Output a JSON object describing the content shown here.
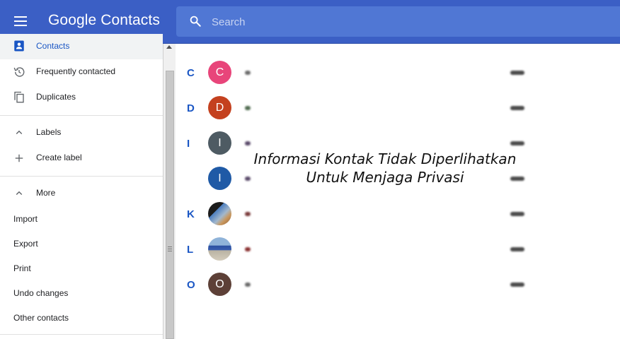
{
  "header": {
    "app_title": "Google Contacts",
    "search_placeholder": "Search"
  },
  "sidebar": {
    "items": [
      {
        "label": "Contacts",
        "icon": "person-icon",
        "active": true
      },
      {
        "label": "Frequently contacted",
        "icon": "history-icon"
      },
      {
        "label": "Duplicates",
        "icon": "copy-icon"
      }
    ],
    "labels_section": {
      "label": "Labels",
      "create_label": "Create label"
    },
    "more_section": {
      "label": "More",
      "items": [
        "Import",
        "Export",
        "Print",
        "Undo changes",
        "Other contacts"
      ]
    }
  },
  "contacts": [
    {
      "letter": "C",
      "initial": "C",
      "avatar_color": "#e8457a"
    },
    {
      "letter": "D",
      "initial": "D",
      "avatar_color": "#c4411f"
    },
    {
      "letter": "I",
      "initial": "I",
      "avatar_color": "#4e5b63"
    },
    {
      "letter": "",
      "initial": "I",
      "avatar_color": "#1f5aa6"
    },
    {
      "letter": "K",
      "initial": "",
      "avatar_color": "#6a7b8a"
    },
    {
      "letter": "L",
      "initial": "",
      "avatar_color": "#8aa0b5"
    },
    {
      "letter": "O",
      "initial": "O",
      "avatar_color": "#5d4037"
    }
  ],
  "overlay_text": {
    "line1": "Informasi Kontak Tidak Diperlihatkan",
    "line2": "Untuk Menjaga Privasi"
  },
  "colors": {
    "header": "#3b5fc5",
    "search_bg": "#5077d4",
    "accent": "#1a56c4"
  }
}
